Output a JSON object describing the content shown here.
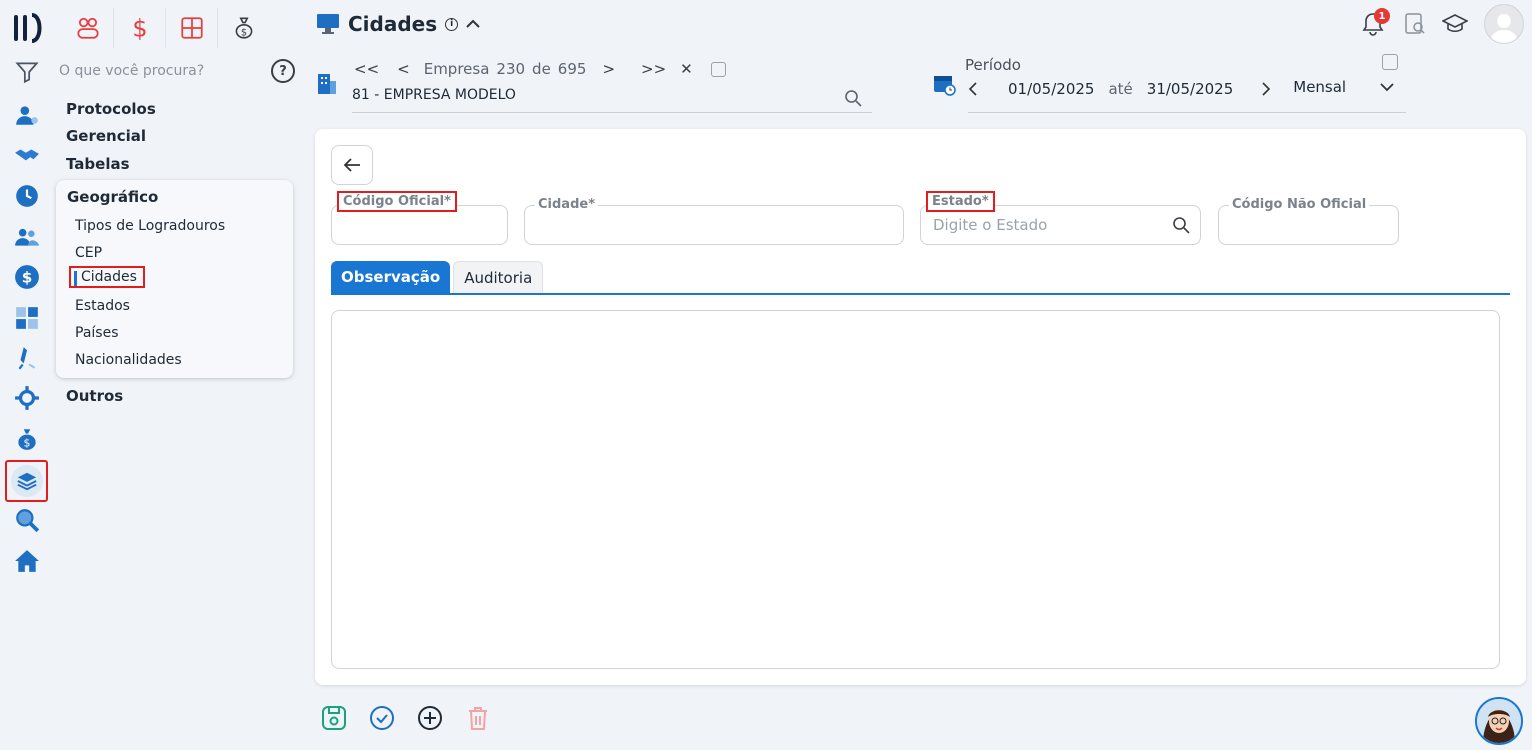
{
  "header": {
    "title": "Cidades",
    "notification_count": "1"
  },
  "menu": {
    "search_placeholder": "O que você procura?",
    "groups": [
      "Protocolos",
      "Gerencial",
      "Tabelas",
      "Outros"
    ],
    "submenu": {
      "title": "Geográfico",
      "items": [
        "Tipos de Logradouros",
        "CEP",
        "Cidades",
        "Estados",
        "Países",
        "Nacionalidades"
      ],
      "active": "Cidades"
    }
  },
  "company": {
    "first": "<<",
    "prev": "<",
    "label": "Empresa",
    "current": "230",
    "sep": "de",
    "total": "695",
    "next": ">",
    "last": ">>",
    "clear": "✕",
    "name": "81 - EMPRESA MODELO"
  },
  "period": {
    "label": "Período",
    "start": "01/05/2025",
    "sep": "até",
    "end": "31/05/2025",
    "mode": "Mensal"
  },
  "form": {
    "codigo_oficial_label": "Código Oficial*",
    "cidade_label": "Cidade*",
    "estado_label": "Estado*",
    "estado_placeholder": "Digite o Estado",
    "codigo_nao_oficial_label": "Código Não Oficial"
  },
  "tabs": [
    "Observação",
    "Auditoria"
  ],
  "colors": {
    "accent": "#1976d2",
    "highlight": "#e11d1d",
    "brand_red": "#e53e3e"
  }
}
